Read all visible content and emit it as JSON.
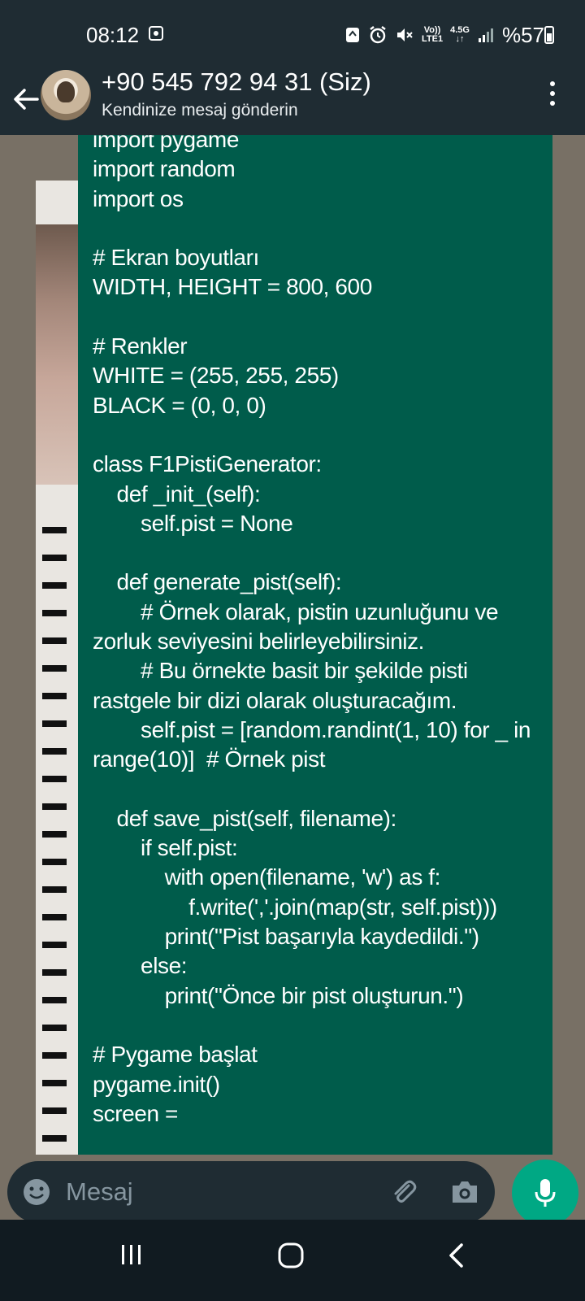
{
  "status_bar": {
    "time": "08:12",
    "network_top": "Vo))",
    "network_bottom": "LTE1",
    "data_type": "4.5G",
    "battery": "%57"
  },
  "header": {
    "contact_name": "+90 545 792 94 31 (Siz)",
    "subtitle": "Kendinize mesaj gönderin"
  },
  "message": {
    "text": "import pygame\nimport random\nimport os\n\n# Ekran boyutları\nWIDTH, HEIGHT = 800, 600\n\n# Renkler\nWHITE = (255, 255, 255)\nBLACK = (0, 0, 0)\n\nclass F1PistiGenerator:\n    def _init_(self):\n        self.pist = None\n\n    def generate_pist(self):\n        # Örnek olarak, pistin uzunluğunu ve zorluk seviyesini belirleyebilirsiniz.\n        # Bu örnekte basit bir şekilde pisti rastgele bir dizi olarak oluşturacağım.\n        self.pist = [random.randint(1, 10) for _ in range(10)]  # Örnek pist\n\n    def save_pist(self, filename):\n        if self.pist:\n            with open(filename, 'w') as f:\n                f.write(','.join(map(str, self.pist)))\n            print(\"Pist başarıyla kaydedildi.\")\n        else:\n            print(\"Önce bir pist oluşturun.\")\n\n# Pygame başlat\npygame.init()\nscreen ="
  },
  "composer": {
    "placeholder": "Mesaj"
  },
  "colors": {
    "header_bg": "#1f2c33",
    "bubble_bg": "#005c4b",
    "accent": "#00a884"
  }
}
